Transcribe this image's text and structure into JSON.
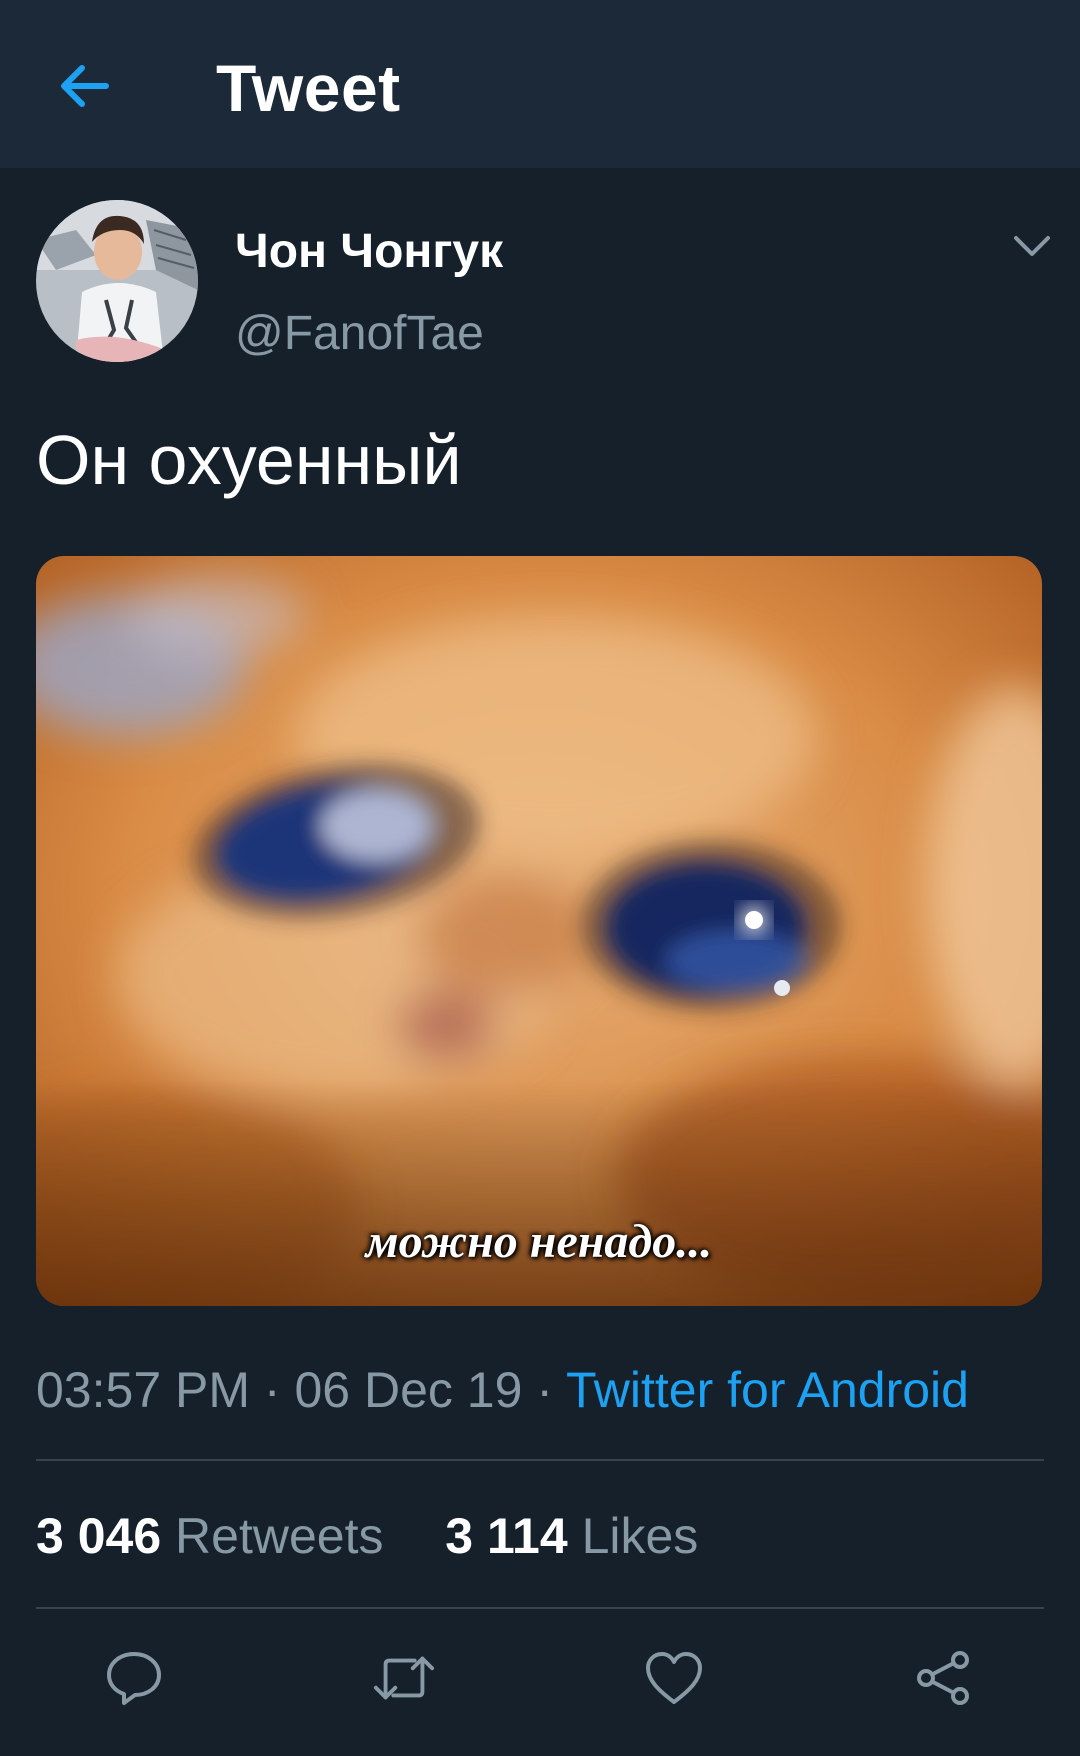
{
  "header": {
    "title": "Tweet",
    "back_icon": "arrow-left-icon",
    "accent": "#1da1f2"
  },
  "tweet": {
    "display_name": "Чон Чонгук",
    "handle": "@FanofTae",
    "text": "Он охуенный",
    "media_caption": "можно ненадо...",
    "time": "03:57 PM",
    "date": "06 Dec 19",
    "separator": "·",
    "source": "Twitter for Android",
    "retweets_count": "3 046",
    "retweets_label": "Retweets",
    "likes_count": "3 114",
    "likes_label": "Likes"
  },
  "actions": [
    "reply-icon",
    "retweet-icon",
    "like-icon",
    "share-icon"
  ],
  "colors": {
    "background": "#15202b",
    "header": "#1c2938",
    "secondary_text": "#8899a6",
    "link": "#1da1f2",
    "divider": "#38444d"
  }
}
